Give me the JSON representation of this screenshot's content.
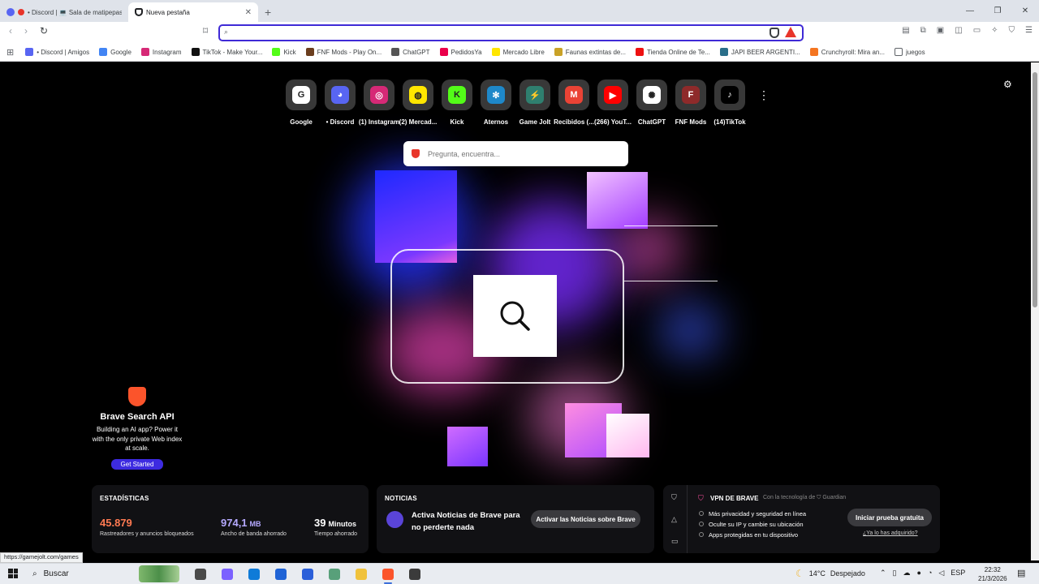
{
  "tabs": [
    {
      "title": "• Discord | 💻 Sala de matipepas",
      "favicon_color": "#5865f2",
      "active": false
    },
    {
      "title": "Nueva pestaña",
      "favicon_color": "#202124",
      "active": true
    }
  ],
  "new_tab_label": "+",
  "window_controls": {
    "minimize": "—",
    "maximize": "❐",
    "close": "✕"
  },
  "toolbar": {
    "back": "‹",
    "forward": "›",
    "reload": "↻",
    "bookmark": "⌑",
    "address_value": "",
    "address_placeholder": ""
  },
  "bookmarks": [
    {
      "label": "• Discord | Amigos",
      "icon_color": "#5865f2"
    },
    {
      "label": "Google",
      "icon_color": "#4285f4"
    },
    {
      "label": "Instagram",
      "icon_color": "#d62976"
    },
    {
      "label": "TikTok - Make Your...",
      "icon_color": "#111111"
    },
    {
      "label": "Kick",
      "icon_color": "#53fc18"
    },
    {
      "label": "FNF Mods - Play On...",
      "icon_color": "#6b3e1e"
    },
    {
      "label": "ChatGPT",
      "icon_color": "#555555"
    },
    {
      "label": "PedidosYa",
      "icon_color": "#ea004b"
    },
    {
      "label": "Mercado Libre",
      "icon_color": "#ffe600"
    },
    {
      "label": "Faunas extintas de...",
      "icon_color": "#c9a227"
    },
    {
      "label": "Tienda Online de Te...",
      "icon_color": "#e11"
    },
    {
      "label": "JAPI BEER ARGENTI...",
      "icon_color": "#2a6f8a"
    },
    {
      "label": "Crunchyroll: Mira an...",
      "icon_color": "#f47521"
    },
    {
      "label": "juegos",
      "icon_color": "#ffffff"
    }
  ],
  "top_sites": [
    {
      "label": "Google",
      "icon_color": "#ffffff",
      "glyph": "G"
    },
    {
      "label": "• Discord",
      "icon_color": "#5865f2",
      "glyph": "◕"
    },
    {
      "label": "(1) Instagram",
      "icon_color": "#d62976",
      "glyph": "◎"
    },
    {
      "label": "(2) Mercad...",
      "icon_color": "#ffe600",
      "glyph": "◍"
    },
    {
      "label": "Kick",
      "icon_color": "#53fc18",
      "glyph": "K"
    },
    {
      "label": "Aternos",
      "icon_color": "#1e88c9",
      "glyph": "✻"
    },
    {
      "label": "Game Jolt",
      "icon_color": "#2f7f6f",
      "glyph": "⚡"
    },
    {
      "label": "Recibidos (...",
      "icon_color": "#ea4335",
      "glyph": "M"
    },
    {
      "label": "(266) YouT...",
      "icon_color": "#ff0000",
      "glyph": "▶"
    },
    {
      "label": "ChatGPT",
      "icon_color": "#ffffff",
      "glyph": "✺"
    },
    {
      "label": "FNF Mods",
      "icon_color": "#8e2a2a",
      "glyph": "F"
    },
    {
      "label": "(14)TikTok",
      "icon_color": "#000000",
      "glyph": "♪"
    }
  ],
  "ask": {
    "placeholder": "Pregunta, encuentra..."
  },
  "promo": {
    "title": "Brave Search API",
    "description": "Building an AI app? Power it with the only private Web index at scale.",
    "button": "Get Started"
  },
  "stats": {
    "heading": "ESTADÍSTICAS",
    "trackers_value": "45.879",
    "trackers_label": "Rastreadores y anuncios bloqueados",
    "bandwidth_value": "974,1",
    "bandwidth_unit": "MB",
    "bandwidth_label": "Ancho de banda ahorrado",
    "time_value": "39",
    "time_unit": "Minutos",
    "time_label": "Tiempo ahorrado",
    "colors": {
      "trackers": "#ff7a52",
      "bandwidth": "#b5a9ff",
      "time": "#ffffff"
    }
  },
  "news": {
    "heading": "NOTICIAS",
    "text": "Activa Noticias de Brave para no perderte nada",
    "button": "Activar las Noticias sobre Brave"
  },
  "vpn": {
    "title": "VPN DE BRAVE",
    "subtitle": "Con la tecnología de ⛉ Guardian",
    "features": [
      "Más privacidad y seguridad en línea",
      "Oculte su IP y cambie su ubicación",
      "Apps protegidas en tu dispositivo"
    ],
    "button": "Iniciar prueba gratuita",
    "link": "¿Ya lo has adquirido?"
  },
  "status_url": "https://gamejolt.com/games",
  "taskbar": {
    "search_label": "Buscar",
    "apps": [
      {
        "name": "task-view",
        "color": "#4a4a4a",
        "active": false
      },
      {
        "name": "copilot",
        "color": "#7b61ff",
        "active": false
      },
      {
        "name": "edge",
        "color": "#0f7bd8",
        "active": false
      },
      {
        "name": "mail",
        "color": "#1f63d6",
        "active": false
      },
      {
        "name": "store",
        "color": "#2b5fd9",
        "active": false
      },
      {
        "name": "app",
        "color": "#58a07a",
        "active": false
      },
      {
        "name": "explorer",
        "color": "#f0c23c",
        "active": false
      },
      {
        "name": "brave",
        "color": "#fb542b",
        "active": true
      },
      {
        "name": "steam-like",
        "color": "#3b3b3b",
        "active": false
      }
    ],
    "weather_temp": "14°C",
    "weather_desc": "Despejado",
    "tray_lang": "ESP",
    "time": "22:32",
    "date": "21/3/2026"
  }
}
